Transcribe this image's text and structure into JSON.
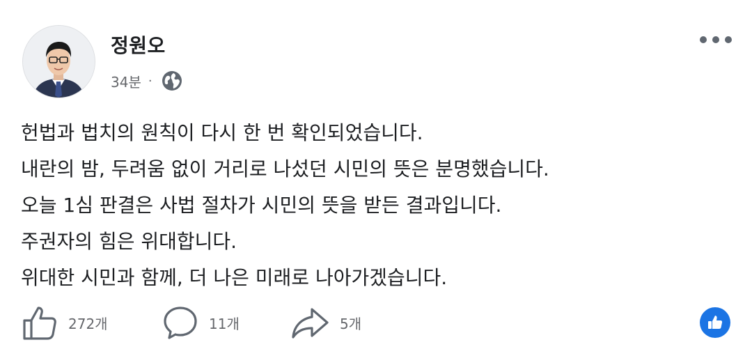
{
  "post": {
    "author": "정원오",
    "time": "34분",
    "separator": "·",
    "audience_icon": "globe-icon",
    "menu_icon": "more-options-icon",
    "lines": [
      "헌법과 법치의 원칙이 다시 한 번 확인되었습니다.",
      "내란의 밤, 두려움 없이 거리로 나섰던 시민의 뜻은 분명했습니다.",
      "오늘 1심 판결은 사법 절차가 시민의 뜻을 받든 결과입니다.",
      "주권자의 힘은 위대합니다.",
      "위대한 시민과 함께, 더 나은 미래로 나아가겠습니다."
    ]
  },
  "actions": {
    "like": {
      "icon": "thumbs-up-icon",
      "count": "272개"
    },
    "comment": {
      "icon": "comment-icon",
      "count": "11개"
    },
    "share": {
      "icon": "share-icon",
      "count": "5개"
    }
  },
  "reaction": {
    "icon": "like-reaction-icon",
    "color": "#1b74e4"
  },
  "colors": {
    "text": "#1c1e21",
    "secondary": "#65676b",
    "accent": "#1b74e4"
  }
}
